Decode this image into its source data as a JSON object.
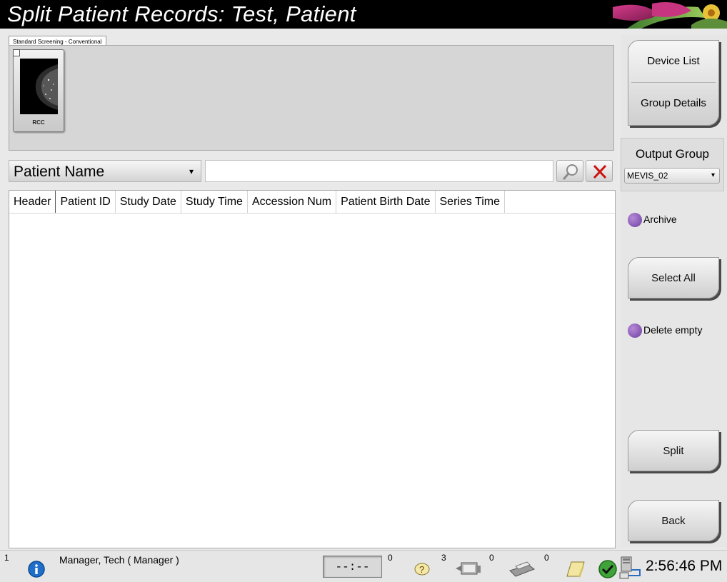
{
  "window": {
    "title": "Split Patient Records: Test, Patient"
  },
  "tabs": [
    {
      "label": "Standard Screening - Conventional"
    }
  ],
  "thumbnails": [
    {
      "label": "RCC",
      "checked": false
    }
  ],
  "filter": {
    "field_selected": "Patient Name",
    "search_value": "",
    "search_icon": "magnifier-icon",
    "clear_icon": "red-x-icon"
  },
  "table": {
    "columns": [
      "Header",
      "Patient ID",
      "Study Date",
      "Study Time",
      "Accession Num",
      "Patient Birth Date",
      "Series Time"
    ],
    "rows": []
  },
  "right_panel": {
    "device_list": "Device List",
    "group_details": "Group Details",
    "output_group_label": "Output Group",
    "output_group_value": "MEVIS_02",
    "archive": "Archive",
    "select_all": "Select All",
    "delete_empty": "Delete empty",
    "split": "Split",
    "back": "Back"
  },
  "statusbar": {
    "notification_count": "1",
    "user": "Manager, Tech ( Manager )",
    "timer": "--:--",
    "help_count": "0",
    "queue_count": "3",
    "print_count": "0",
    "notes_count": "0",
    "time": "2:56:46 PM"
  },
  "colors": {
    "accent_radio": "#7b4aab",
    "clear_red": "#cc1111",
    "title_bg": "#000000"
  }
}
